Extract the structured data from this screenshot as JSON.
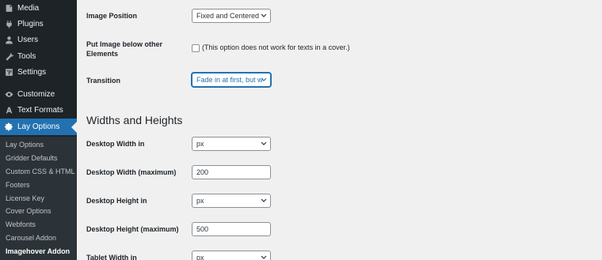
{
  "sidebar": {
    "menu": [
      {
        "label": "Media",
        "icon": "media-icon"
      },
      {
        "label": "Plugins",
        "icon": "plugins-icon"
      },
      {
        "label": "Users",
        "icon": "users-icon"
      },
      {
        "label": "Tools",
        "icon": "tools-icon"
      },
      {
        "label": "Settings",
        "icon": "settings-icon"
      },
      {
        "label": "Customize",
        "icon": "customize-icon"
      },
      {
        "label": "Text Formats",
        "icon": "text-formats-icon"
      },
      {
        "label": "Lay Options",
        "icon": "gear-icon"
      }
    ],
    "submenu": [
      "Lay Options",
      "Gridder Defaults",
      "Custom CSS & HTML",
      "Footers",
      "License Key",
      "Cover Options",
      "Webfonts",
      "Carousel Addon",
      "Imagehover Addon"
    ]
  },
  "form": {
    "image_position": {
      "label": "Image Position",
      "value": "Fixed and Centered"
    },
    "put_below": {
      "label_line1": "Put Image below other",
      "label_line2": "Elements",
      "note": "(This option does not work for texts in a cover.)"
    },
    "transition": {
      "label": "Transition",
      "value": "Fade in at first, but w"
    },
    "section_title": "Widths and Heights",
    "desktop_width_in": {
      "label": "Desktop Width in",
      "value": "px"
    },
    "desktop_width_max": {
      "label": "Desktop Width (maximum)",
      "value": "200"
    },
    "desktop_height_in": {
      "label": "Desktop Height in",
      "value": "px"
    },
    "desktop_height_max": {
      "label": "Desktop Height (maximum)",
      "value": "500"
    },
    "tablet_width_in": {
      "label": "Tablet Width in",
      "value": "px"
    }
  },
  "colors": {
    "sidebar_bg": "#1d2327",
    "active_bg": "#2271b1",
    "main_bg": "#f0f0f1"
  }
}
